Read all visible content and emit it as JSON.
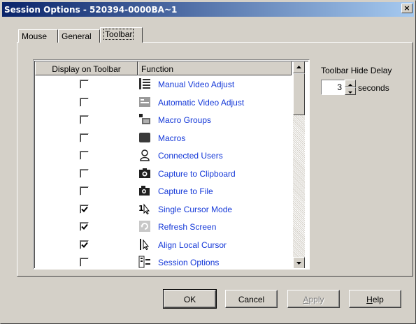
{
  "window": {
    "title": "Session Options - 520394-0000BA~1",
    "close_glyph": "×"
  },
  "tabs": [
    {
      "label": "Mouse",
      "active": false
    },
    {
      "label": "General",
      "active": false
    },
    {
      "label": "Toolbar",
      "active": true
    }
  ],
  "table": {
    "headers": {
      "display": "Display on Toolbar",
      "function": "Function"
    },
    "rows": [
      {
        "label": "Manual Video Adjust",
        "checked": false,
        "icon": "manual-video-adjust-icon"
      },
      {
        "label": "Automatic Video Adjust",
        "checked": false,
        "icon": "automatic-video-adjust-icon"
      },
      {
        "label": "Macro Groups",
        "checked": false,
        "icon": "macro-groups-icon"
      },
      {
        "label": "Macros",
        "checked": false,
        "icon": "macros-icon"
      },
      {
        "label": "Connected Users",
        "checked": false,
        "icon": "connected-users-icon"
      },
      {
        "label": "Capture to Clipboard",
        "checked": false,
        "icon": "capture-clipboard-icon"
      },
      {
        "label": "Capture to File",
        "checked": false,
        "icon": "capture-file-icon"
      },
      {
        "label": "Single Cursor Mode",
        "checked": true,
        "icon": "single-cursor-icon"
      },
      {
        "label": "Refresh Screen",
        "checked": true,
        "icon": "refresh-screen-icon"
      },
      {
        "label": "Align Local Cursor",
        "checked": true,
        "icon": "align-cursor-icon"
      },
      {
        "label": "Session Options",
        "checked": false,
        "icon": "session-options-icon"
      }
    ]
  },
  "toolbar_delay": {
    "label": "Toolbar Hide Delay",
    "value": "3",
    "unit": "seconds"
  },
  "buttons": {
    "ok": "OK",
    "cancel": "Cancel",
    "apply_prefix": "",
    "apply_underline": "A",
    "apply_rest": "pply",
    "help_prefix": "",
    "help_underline": "H",
    "help_rest": "elp"
  },
  "colors": {
    "title_start": "#0a246a",
    "title_end": "#a6caf0",
    "link": "#1438d8",
    "face": "#d4d0c8"
  }
}
